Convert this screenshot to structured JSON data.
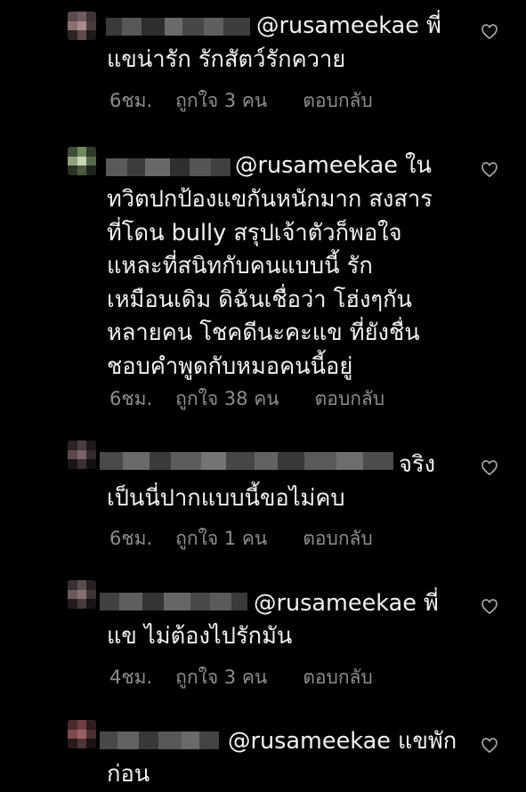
{
  "colors": {
    "background": "#000000",
    "text": "#f2f2f2",
    "secondary": "#8e8e8e"
  },
  "comments": [
    {
      "line1": "@rusameekae พี่",
      "lines": "แขน่ารัก รักสัตว์รักควาย",
      "time": "6ชม.",
      "likes": "ถูกใจ 3 คน",
      "reply": "ตอบกลับ",
      "icon": "heart-outline-icon"
    },
    {
      "line1": "@rusameekae ใน",
      "lines": "ทวิตปกป้องแขกันหนักมาก สงสาร\nที่โดน bully สรุปเจ้าตัวก็พอใจ\nแหละที่สนิทกับคนแบบนี้ รัก\nเหมือนเดิม ดิฉันเชื่อว่า โฮ่งๆกัน\nหลายคน โชคดีนะคะแข ที่ยังชื่น\nชอบคำพูดกับหมอคนนี้อยู่",
      "time": "6ชม.",
      "likes": "ถูกใจ 38 คน",
      "reply": "ตอบกลับ",
      "icon": "heart-outline-icon"
    },
    {
      "line1": "จริง",
      "lines": "เป็นนี่ปากแบบนี้ขอไม่คบ",
      "time": "6ชม.",
      "likes": "ถูกใจ 1 คน",
      "reply": "ตอบกลับ",
      "icon": "heart-outline-icon"
    },
    {
      "line1": "@rusameekae พี่",
      "lines": "แข ไม่ต้องไปรักมัน",
      "time": "4ชม.",
      "likes": "ถูกใจ 3 คน",
      "reply": "ตอบกลับ",
      "icon": "heart-outline-icon"
    },
    {
      "line1": "@rusameekae แขพัก",
      "lines": "ก่อน",
      "icon": "heart-outline-icon"
    }
  ]
}
